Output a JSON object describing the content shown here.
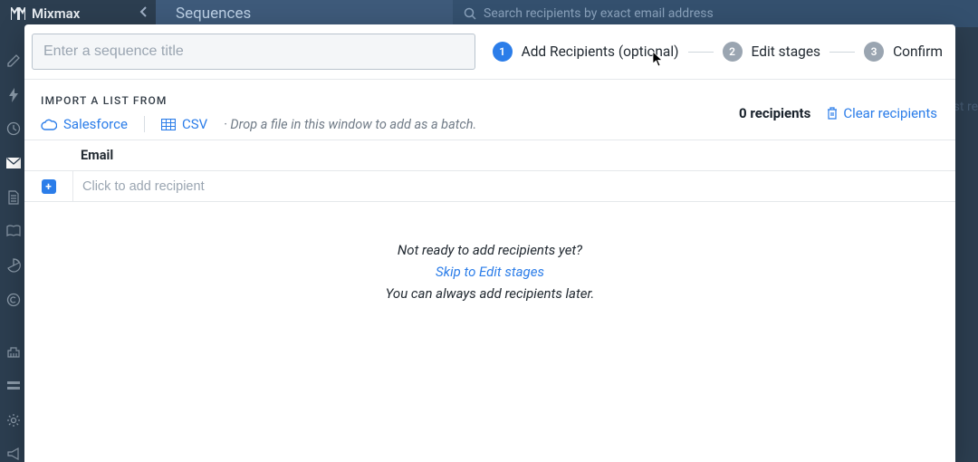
{
  "topbar": {
    "brand": "Mixmax",
    "page_title": "Sequences",
    "search_placeholder": "Search recipients by exact email address"
  },
  "modal": {
    "title_placeholder": "Enter a sequence title",
    "steps": [
      {
        "num": "1",
        "label": "Add Recipients (optional)",
        "active": true
      },
      {
        "num": "2",
        "label": "Edit stages",
        "active": false
      },
      {
        "num": "3",
        "label": "Confirm",
        "active": false
      }
    ],
    "import_label": "IMPORT A LIST FROM",
    "sources": {
      "salesforce": "Salesforce",
      "csv": "CSV",
      "hint": "· Drop a file in this window to add as a batch."
    },
    "count_label": "0 recipients",
    "clear_label": "Clear recipients",
    "table_header": "Email",
    "add_placeholder": "Click to add recipient",
    "empty_msg": {
      "line1": "Not ready to add recipients yet?",
      "skip": "Skip to Edit stages",
      "line2": "You can always add recipients later."
    }
  },
  "bg_snippet": "st re"
}
